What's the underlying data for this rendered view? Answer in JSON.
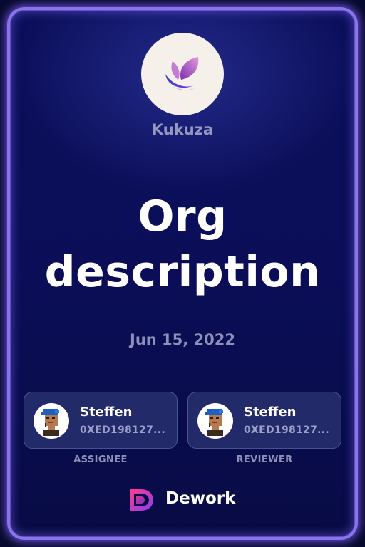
{
  "org": {
    "name": "Kukuza",
    "logo_icon": "leaf-logo-icon"
  },
  "task": {
    "title": "Org description",
    "date": "Jun 15, 2022"
  },
  "assignee": {
    "name": "Steffen",
    "address": "0XED198127...",
    "role_label": "ASSIGNEE",
    "avatar_icon": "pixel-punk-avatar-icon"
  },
  "reviewer": {
    "name": "Steffen",
    "address": "0XED198127...",
    "role_label": "REVIEWER",
    "avatar_icon": "pixel-punk-avatar-icon"
  },
  "brand": {
    "name": "Dework",
    "logo_icon": "dework-logo-icon"
  },
  "colors": {
    "accent_glow": "#8a72f0",
    "card_bg": "#0b0f5a",
    "muted_text": "#8d90b8"
  }
}
